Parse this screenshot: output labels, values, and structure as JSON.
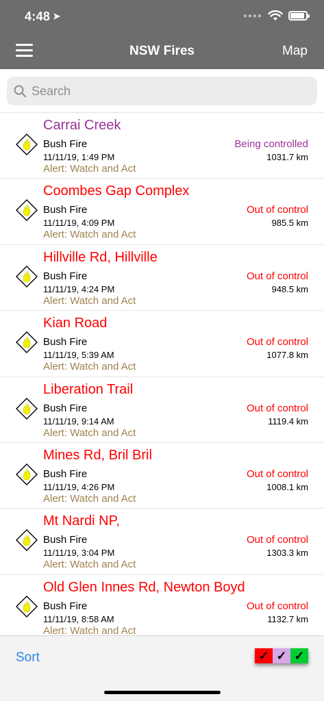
{
  "status_bar": {
    "time": "4:48"
  },
  "nav": {
    "title": "NSW Fires",
    "map_label": "Map"
  },
  "search": {
    "placeholder": "Search"
  },
  "colors": {
    "header_bg": "#6d6d6d",
    "red": "#ff0000",
    "purple": "#993399",
    "alert": "#a0824f",
    "link_blue": "#2b85e6",
    "fire_yellow": "#f2f200"
  },
  "fires": [
    {
      "name": "Carrai Creek",
      "type": "Bush Fire",
      "time": "11/11/19, 1:49 PM",
      "alert": "Alert: Watch and Act",
      "status": "Being controlled",
      "distance": "1031.7 km",
      "color": "#993399"
    },
    {
      "name": "Coombes Gap Complex",
      "type": "Bush Fire",
      "time": "11/11/19, 4:09 PM",
      "alert": "Alert: Watch and Act",
      "status": "Out of control",
      "distance": "985.5 km",
      "color": "#ff0000"
    },
    {
      "name": "Hillville Rd, Hillville",
      "type": "Bush Fire",
      "time": "11/11/19, 4:24 PM",
      "alert": "Alert: Watch and Act",
      "status": "Out of control",
      "distance": "948.5 km",
      "color": "#ff0000"
    },
    {
      "name": "Kian Road",
      "type": "Bush Fire",
      "time": "11/11/19, 5:39 AM",
      "alert": "Alert: Watch and Act",
      "status": "Out of control",
      "distance": "1077.8 km",
      "color": "#ff0000"
    },
    {
      "name": "Liberation Trail",
      "type": "Bush Fire",
      "time": "11/11/19, 9:14 AM",
      "alert": "Alert: Watch and Act",
      "status": "Out of control",
      "distance": "1119.4 km",
      "color": "#ff0000"
    },
    {
      "name": "Mines Rd, Bril Bril",
      "type": "Bush Fire",
      "time": "11/11/19, 4:26 PM",
      "alert": "Alert: Watch and Act",
      "status": "Out of control",
      "distance": "1008.1 km",
      "color": "#ff0000"
    },
    {
      "name": "Mt Nardi NP,",
      "type": "Bush Fire",
      "time": "11/11/19, 3:04 PM",
      "alert": "Alert: Watch and Act",
      "status": "Out of control",
      "distance": "1303.3 km",
      "color": "#ff0000"
    },
    {
      "name": "Old Glen Innes Rd, Newton Boyd",
      "type": "Bush Fire",
      "time": "11/11/19, 8:58 AM",
      "alert": "Alert: Watch and Act",
      "status": "Out of control",
      "distance": "1132.7 km",
      "color": "#ff0000"
    }
  ],
  "toolbar": {
    "sort_label": "Sort",
    "filters": [
      {
        "name": "red-filter",
        "color": "#ff0000",
        "mark": "✓"
      },
      {
        "name": "purple-filter",
        "color": "#d6a8e8",
        "mark": "✓"
      },
      {
        "name": "green-filter",
        "color": "#00cc33",
        "mark": "✓"
      }
    ]
  }
}
